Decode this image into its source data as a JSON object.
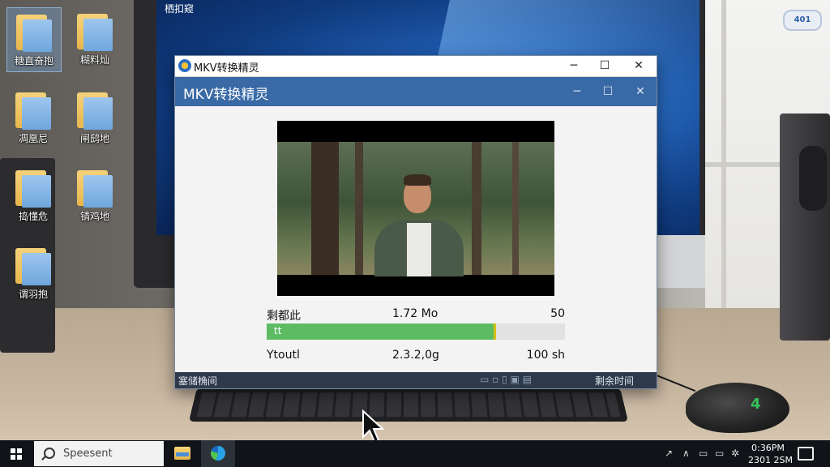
{
  "desktop": {
    "icons": [
      {
        "label": "糖直奋抱",
        "selected": true
      },
      {
        "label": "糊料灿",
        "selected": false
      },
      {
        "label": "凋凰尼",
        "selected": false
      },
      {
        "label": "闸鸱地",
        "selected": false
      },
      {
        "label": "捣懂危",
        "selected": false
      },
      {
        "label": "锖鸡地",
        "selected": false
      },
      {
        "label": "谓羽抱",
        "selected": false
      }
    ],
    "screen_label": "栖扣窥",
    "tray_badge": "401"
  },
  "app": {
    "window_title": "MKV转换精灵",
    "header_title": "MKV转换精灵",
    "controls": {
      "minimize": "─",
      "maximize": "☐",
      "close": "✕"
    },
    "row1": {
      "label": "剩都此",
      "size": "1.72 Mo",
      "value": "50"
    },
    "progress": {
      "label": "tt",
      "percent": 76
    },
    "row2": {
      "label": "Ytoutl",
      "version": "2.3.2,0g",
      "time": "100 sh"
    },
    "status_bar": {
      "left": "塞储桷间",
      "middle": "▭ ▫ ▯ ▣ ▤",
      "right": "剩余时间"
    }
  },
  "taskbar": {
    "search_placeholder": "Speesent",
    "clock_time": "0:36PM",
    "clock_date": "2301 2SM",
    "tray_glyphs": [
      "↗",
      "∧",
      "▭",
      "▭",
      "✲"
    ]
  },
  "colors": {
    "header": "#3a6aa6",
    "progress_fill": "#5dbb63",
    "status_bar": "#2e3a4c",
    "taskbar": "#101418"
  }
}
